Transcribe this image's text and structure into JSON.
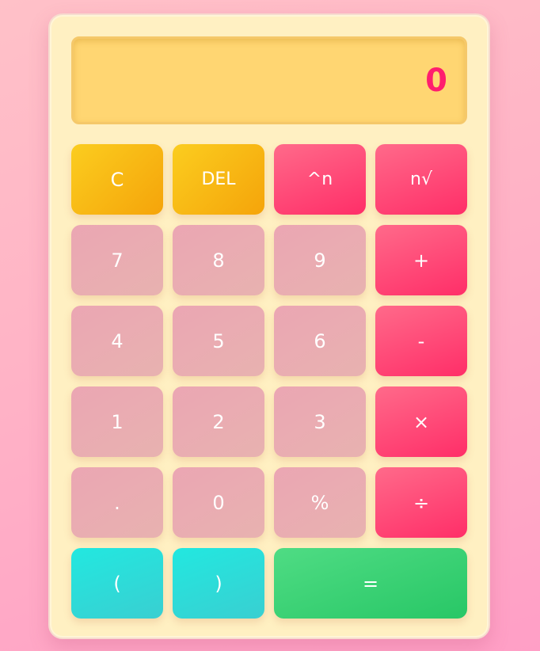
{
  "display": {
    "value": "0"
  },
  "keys": {
    "clear": "C",
    "delete": "DEL",
    "power": "^n",
    "root": "n√",
    "seven": "7",
    "eight": "8",
    "nine": "9",
    "plus": "+",
    "four": "4",
    "five": "5",
    "six": "6",
    "minus": "-",
    "one": "1",
    "two": "2",
    "three": "3",
    "multiply": "×",
    "decimal": ".",
    "zero": "0",
    "percent": "%",
    "divide": "÷",
    "open_paren": "(",
    "close_paren": ")",
    "equals": "="
  },
  "colors": {
    "display_text": "#ff1e6e",
    "function_keys": "#f8b818",
    "operator_keys": "#ff4a76",
    "number_keys": "#eaabb2",
    "paren_keys": "#2ee0dc",
    "equals_key": "#3dd277"
  }
}
